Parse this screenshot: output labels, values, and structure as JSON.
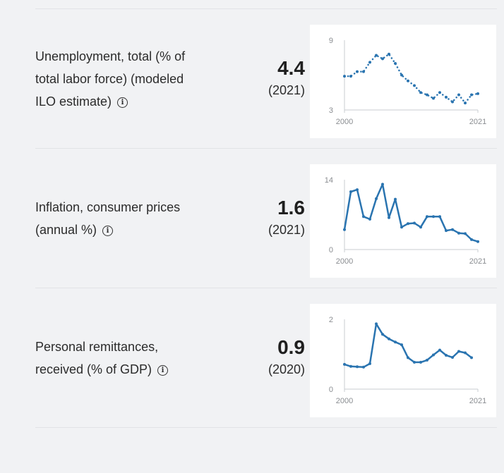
{
  "indicators": [
    {
      "label": "Unemployment, total (% of total labor force) (modeled ILO estimate)",
      "value": "4.4",
      "year": "(2021)",
      "info_icon": "info-icon"
    },
    {
      "label": "Inflation, consumer prices (annual %)",
      "value": "1.6",
      "year": "(2021)",
      "info_icon": "info-icon"
    },
    {
      "label": "Personal remittances, received (% of GDP)",
      "value": "0.9",
      "year": "(2020)",
      "info_icon": "info-icon"
    }
  ],
  "chart_data": [
    {
      "type": "line",
      "title": "",
      "xlabel": "",
      "ylabel": "",
      "x": [
        2000,
        2001,
        2002,
        2003,
        2004,
        2005,
        2006,
        2007,
        2008,
        2009,
        2010,
        2011,
        2012,
        2013,
        2014,
        2015,
        2016,
        2017,
        2018,
        2019,
        2020,
        2021
      ],
      "series": [
        {
          "values": [
            5.9,
            5.9,
            6.3,
            6.3,
            7.1,
            7.7,
            7.4,
            7.8,
            7.0,
            6.0,
            5.5,
            5.1,
            4.5,
            4.3,
            4.0,
            4.5,
            4.1,
            3.7,
            4.3,
            3.6,
            4.3,
            4.4
          ]
        }
      ],
      "ylim": [
        3,
        9
      ],
      "y_ticks": [
        "9",
        "3"
      ],
      "x_ticks": [
        "2000",
        "2021"
      ],
      "grid": false,
      "line_color": "#2a74b0",
      "style": "dotted"
    },
    {
      "type": "line",
      "title": "",
      "xlabel": "",
      "ylabel": "",
      "x": [
        2000,
        2001,
        2002,
        2003,
        2004,
        2005,
        2006,
        2007,
        2008,
        2009,
        2010,
        2011,
        2012,
        2013,
        2014,
        2015,
        2016,
        2017,
        2018,
        2019,
        2020,
        2021
      ],
      "series": [
        {
          "values": [
            4.0,
            11.6,
            12.0,
            6.6,
            6.1,
            10.2,
            13.1,
            6.4,
            10.1,
            4.5,
            5.2,
            5.3,
            4.5,
            6.6,
            6.6,
            6.6,
            3.8,
            4.0,
            3.3,
            3.2,
            2.0,
            1.6
          ]
        }
      ],
      "ylim": [
        0,
        14
      ],
      "y_ticks": [
        "14",
        "0"
      ],
      "x_ticks": [
        "2000",
        "2021"
      ],
      "grid": false,
      "line_color": "#2a74b0",
      "style": "solid"
    },
    {
      "type": "line",
      "title": "",
      "xlabel": "",
      "ylabel": "",
      "x": [
        2000,
        2001,
        2002,
        2003,
        2004,
        2005,
        2006,
        2007,
        2008,
        2009,
        2010,
        2011,
        2012,
        2013,
        2014,
        2015,
        2016,
        2017,
        2018,
        2019,
        2020
      ],
      "series": [
        {
          "values": [
            0.71,
            0.65,
            0.64,
            0.63,
            0.73,
            1.87,
            1.57,
            1.44,
            1.35,
            1.27,
            0.9,
            0.77,
            0.77,
            0.83,
            0.98,
            1.12,
            0.97,
            0.91,
            1.08,
            1.04,
            0.9
          ]
        }
      ],
      "ylim": [
        0,
        2
      ],
      "y_ticks": [
        "2",
        "0"
      ],
      "x_ticks": [
        "2000",
        "2021"
      ],
      "grid": false,
      "line_color": "#2a74b0",
      "style": "mixed"
    }
  ]
}
